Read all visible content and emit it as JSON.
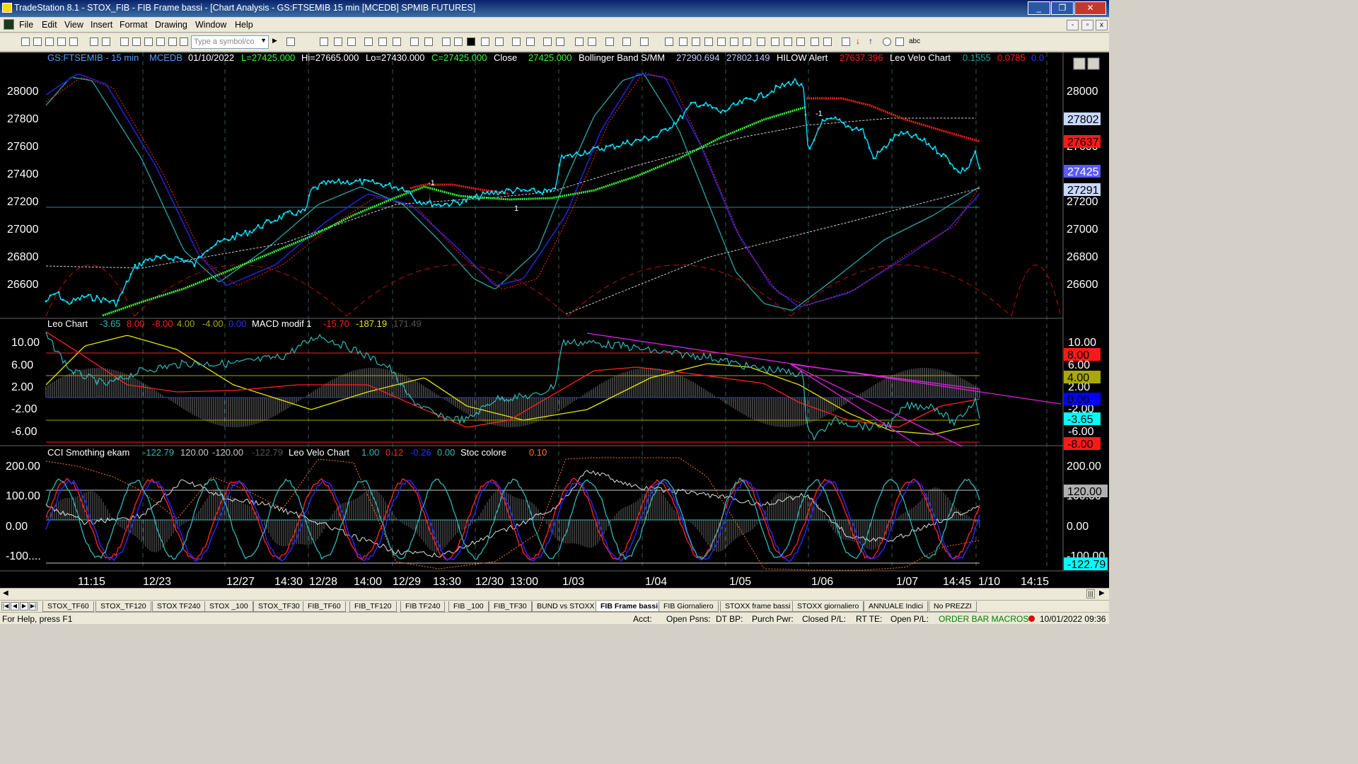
{
  "window": {
    "title": "TradeStation 8.1 - STOX_FIB - FIB Frame bassi - [Chart Analysis - GS:FTSEMIB  15 min  [MCEDB] SPMIB FUTURES]",
    "minimize": "_",
    "restore": "❐",
    "close": "✕"
  },
  "menu": [
    "File",
    "Edit",
    "View",
    "Insert",
    "Format",
    "Drawing",
    "Window",
    "Help"
  ],
  "toolbar": {
    "symbol_placeholder": "Type a symbol/co",
    "abc": "abc"
  },
  "chart": {
    "header": {
      "symbol": "GS:FTSEMIB - 15 min",
      "source": "MCEDB",
      "date": "01/10/2022",
      "last": "L=27425.000",
      "hi": "Hi=27665.000",
      "lo": "Lo=27430.000",
      "close": "C=27425.000",
      "close_label": "Close",
      "close_val": "27425.000",
      "bb_name": "Bollinger Band S/MM",
      "bb_v1": "27290.694",
      "bb_v2": "27802.149",
      "hilow_name": "HILOW Alert",
      "hilow_val": "27637.396",
      "leo_name": "Leo Velo Chart",
      "leo_v1": "0.1555",
      "leo_v2": "0.0785",
      "leo_v3": "0.0"
    },
    "price_axis": [
      "28000",
      "27800",
      "27600",
      "27400",
      "27200",
      "27000",
      "26800",
      "26600"
    ],
    "price_badges": [
      {
        "v": "27802",
        "color": "#c8d8ff",
        "tc": "#000"
      },
      {
        "v": "27637",
        "color": "#ff1a1a",
        "tc": "#000"
      },
      {
        "v": "27425",
        "color": "#5a5aff",
        "tc": "#fff"
      },
      {
        "v": "27291",
        "color": "#c8d8ff",
        "tc": "#000"
      }
    ],
    "signals": {
      "m1a": "-1",
      "m1b": "-1",
      "p1": "1"
    },
    "p2_header": {
      "name": "Leo Chart",
      "v1": "-3.65",
      "v2": "8.00",
      "v3": "-8.00",
      "v4": "4.00",
      "v5": "-4.00",
      "v6": "0.00",
      "macd": "MACD modif 1",
      "m1": "-15.70",
      "m2": "-187.19",
      "m3": "171.49"
    },
    "p2_axis": [
      "10.00",
      "6.00",
      "2.00",
      "-2.00",
      "-6.00"
    ],
    "p2_badges": [
      {
        "v": "8.00",
        "color": "#ff1a1a",
        "tc": "#000"
      },
      {
        "v": "4.00",
        "color": "#a8a800",
        "tc": "#000"
      },
      {
        "v": "0.00",
        "color": "#0000ff",
        "tc": "#000"
      },
      {
        "v": "-3.65",
        "color": "#00ffff",
        "tc": "#000"
      },
      {
        "v": "-8.00",
        "color": "#ff1a1a",
        "tc": "#000"
      }
    ],
    "p2_axis_labels_right": [
      "10.00",
      "6.00",
      "2.00",
      "-2.00",
      "-6.00"
    ],
    "p3_header": {
      "name": "CCI Smothing ekam",
      "v1": "-122.79",
      "v2": "120.00",
      "v3": "-120.00",
      "v4": "-122.79",
      "leo": "Leo Velo Chart",
      "l1": "1.00",
      "l2": "0.12",
      "l3": "-0.26",
      "l4": "0.00",
      "stoc": "Stoc colore",
      "s1": "0.10"
    },
    "p3_axis": [
      "200.00",
      "100.00",
      "0.00",
      "-100...."
    ],
    "p3_axis_right": [
      "200.00",
      "100.00",
      "0.00",
      "-100.00"
    ],
    "p3_badges": [
      {
        "v": "120.00",
        "color": "#b0b0b0",
        "tc": "#000"
      },
      {
        "v": "-122.79",
        "color": "#00ffff",
        "tc": "#000"
      }
    ],
    "time_axis": [
      "11:15",
      "12/23",
      "12/27",
      "14:30",
      "12/28",
      "14:00",
      "12/29",
      "13:30",
      "12/30",
      "13:00",
      "1/03",
      "1/04",
      "1/05",
      "1/06",
      "1/07",
      "14:45",
      "1/10",
      "14:15"
    ]
  },
  "tabs": [
    "STOX_TF60",
    "STOX_TF120",
    "STOX TF240",
    "STOX _100",
    "STOX_TF30",
    "FIB_TF60",
    "FIB_TF120",
    "FIB TF240",
    "FIB _100",
    "FIB_TF30",
    "BUND vs STOXX",
    "FIB Frame bassi",
    "FIB Giornaliero",
    "STOXX frame bassi",
    "STOXX giornaliero",
    "ANNUALE Indici",
    "No PREZZI"
  ],
  "active_tab": "FIB Frame bassi",
  "status": {
    "help": "For Help, press F1",
    "acct": "Acct:",
    "open_psns": "Open Psns:",
    "dt_bp": "DT BP:",
    "purch": "Purch Pwr:",
    "closed": "Closed P/L:",
    "rt": "RT TE:",
    "open_pl": "Open P/L:",
    "macros": "ORDER BAR  MACROS",
    "datetime": "10/01/2022 09:36"
  },
  "colors": {
    "price": "#00e5ff",
    "green": "#33ff33",
    "red": "#ff2020",
    "grid": "#3a3a3a",
    "axis_text": "#ffffff"
  }
}
